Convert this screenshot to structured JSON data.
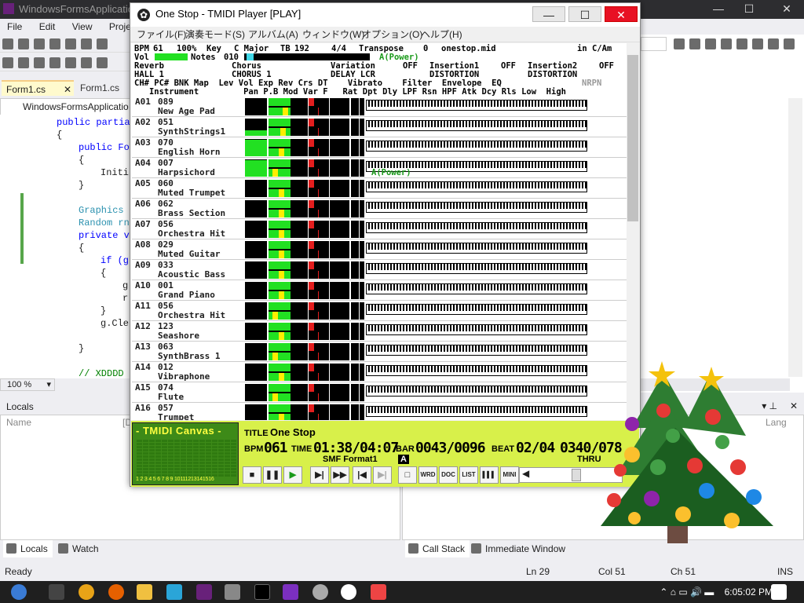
{
  "vs": {
    "title": "WindowsFormsApplication",
    "menu": [
      "File",
      "Edit",
      "View",
      "Project"
    ],
    "tabs": [
      "Form1.cs",
      "Form1.cs [D"
    ],
    "nav_combo": "WindowsFormsApplicatio",
    "code_lines": [
      {
        "t": "public partia",
        "k": "kw"
      },
      {
        "t": "{",
        "k": ""
      },
      {
        "t": "public Fo",
        "k": "kw"
      },
      {
        "t": "{",
        "k": ""
      },
      {
        "t": "Initi",
        "k": ""
      },
      {
        "t": "}",
        "k": ""
      },
      {
        "t": "",
        "k": ""
      },
      {
        "t": "Graphics",
        "k": "ty"
      },
      {
        "t": "Random rn",
        "k": "ty"
      },
      {
        "t": "private v",
        "k": "kw"
      },
      {
        "t": "{",
        "k": ""
      },
      {
        "t": "if (g",
        "k": "kw"
      },
      {
        "t": "{",
        "k": ""
      },
      {
        "t": "g",
        "k": ""
      },
      {
        "t": "r",
        "k": ""
      },
      {
        "t": "}",
        "k": ""
      },
      {
        "t": "g.Cle",
        "k": ""
      },
      {
        "t": "",
        "k": ""
      },
      {
        "t": "}",
        "k": ""
      },
      {
        "t": "",
        "k": ""
      },
      {
        "t": "// XDDDD",
        "k": "cm"
      }
    ],
    "zoom": "100 %",
    "locals_title": "Locals",
    "locals_col_name": "Name",
    "locals_col_value": "[D",
    "lang_col": "Lang",
    "bottom_tabs_left": [
      "Locals",
      "Watch"
    ],
    "bottom_tabs_right": [
      "Call Stack",
      "Immediate Window"
    ],
    "status": {
      "ready": "Ready",
      "ln": "Ln 29",
      "col": "Col 51",
      "ch": "Ch 51",
      "ins": "INS"
    }
  },
  "taskbar": {
    "time": "6:05:02 PM"
  },
  "tmidi": {
    "title": "One Stop - TMIDI Player [PLAY]",
    "menu": [
      "ファイル(F)",
      "演奏モード(S)",
      "アルバム(A)",
      "ウィンドウ(W)",
      "オプション(O)",
      "ヘルプ(H)"
    ],
    "hdr": {
      "bpm_label": "BPM",
      "bpm": "61",
      "pct": "100%",
      "key_label": "Key",
      "key": "C Major",
      "tb_label": "TB",
      "tb": "192",
      "ts": "4/4",
      "transpose_label": "Transpose",
      "transpose": "0",
      "file": "onestop.mid",
      "in_label": "in C/Am",
      "vol_label": "Vol",
      "notes_label": "Notes",
      "notes": "010",
      "power": "A(Power)",
      "reverb_label": "Reverb",
      "chorus_label": "Chorus",
      "variation_label": "Variation",
      "variation": "OFF",
      "ins1_label": "Insertion1",
      "ins1": "OFF",
      "ins2_label": "Insertion2",
      "ins2": "OFF",
      "reverb": "HALL 1",
      "chorus": "CHORUS 1",
      "delay": "DELAY LCR",
      "dist1": "DISTORTION",
      "dist2": "DISTORTION",
      "cols1": "CH# PC# BNK Map  Lev Vol Exp Rev Crs DT    Vibrato    Filter  Envelope  EQ",
      "nrpn": "NRPN",
      "cols2": "   Instrument         Pan P.B Mod Var F   Rat Dpt Dly LPF Rsn HPF Atk Dcy Rls Low  High"
    },
    "channels": [
      {
        "ch": "A01",
        "pc": "089",
        "name": "New Age Pad",
        "lev": 0.0,
        "vol": 0.55,
        "pan": 0.35
      },
      {
        "ch": "A02",
        "pc": "051",
        "name": "SynthStrings1",
        "lev": 0.3,
        "vol": 0.55,
        "pan": 0.3
      },
      {
        "ch": "A03",
        "pc": "070",
        "name": "English Horn",
        "lev": 0.95,
        "vol": 0.55,
        "pan": 0.25
      },
      {
        "ch": "A04",
        "pc": "007",
        "name": "Harpsichord",
        "lev": 0.95,
        "vol": 0.55,
        "pan": 0.1
      },
      {
        "ch": "A05",
        "pc": "060",
        "name": "Muted Trumpet",
        "lev": 0.0,
        "vol": 0.55,
        "pan": 0.25
      },
      {
        "ch": "A06",
        "pc": "062",
        "name": "Brass Section",
        "lev": 0.0,
        "vol": 0.55,
        "pan": 0.25
      },
      {
        "ch": "A07",
        "pc": "056",
        "name": "Orchestra Hit",
        "lev": 0.0,
        "vol": 0.55,
        "pan": 0.25
      },
      {
        "ch": "A08",
        "pc": "029",
        "name": "Muted Guitar",
        "lev": 0.0,
        "vol": 0.55,
        "pan": 0.25
      },
      {
        "ch": "A09",
        "pc": "033",
        "name": "Acoustic Bass",
        "lev": 0.0,
        "vol": 0.55,
        "pan": 0.25
      },
      {
        "ch": "A10",
        "pc": "001",
        "name": "Grand Piano",
        "lev": 0.0,
        "vol": 0.55,
        "pan": 0.25
      },
      {
        "ch": "A11",
        "pc": "056",
        "name": "Orchestra Hit",
        "lev": 0.0,
        "vol": 0.55,
        "pan": 0.1
      },
      {
        "ch": "A12",
        "pc": "123",
        "name": "Seashore",
        "lev": 0.0,
        "vol": 0.55,
        "pan": 0.25
      },
      {
        "ch": "A13",
        "pc": "063",
        "name": "SynthBrass 1",
        "lev": 0.0,
        "vol": 0.55,
        "pan": 0.1
      },
      {
        "ch": "A14",
        "pc": "012",
        "name": "Vibraphone",
        "lev": 0.0,
        "vol": 0.55,
        "pan": 0.25
      },
      {
        "ch": "A15",
        "pc": "074",
        "name": "Flute",
        "lev": 0.0,
        "vol": 0.55,
        "pan": 0.1
      },
      {
        "ch": "A16",
        "pc": "057",
        "name": "Trumpet",
        "lev": 0.0,
        "vol": 0.55,
        "pan": 0.25
      }
    ],
    "overlay_power": "A(Power)",
    "canvas": {
      "title": "- TMIDI Canvas -",
      "nums": "1 2 3 4 5 6 7 8 9 10111213141516"
    },
    "info": {
      "title_label": "TITLE",
      "title": "One Stop",
      "bpm_label": "BPM",
      "bpm": "061",
      "time_label": "TIME",
      "time": "01:38/04:07",
      "bar_label": "BAR",
      "bar": "0043/0096",
      "beat_label": "BEAT",
      "beat": "02/04",
      "tick": "0340/078",
      "format": "SMF Format1",
      "a_mark": "A",
      "thru": "THRU"
    },
    "transport": [
      "■",
      "❚❚",
      "▶",
      "▶|",
      "▶▶",
      "|◀",
      "▶|",
      "□",
      "WRD",
      "DOC",
      "LIST",
      "▌▌▌",
      "MINI",
      "◀"
    ]
  }
}
